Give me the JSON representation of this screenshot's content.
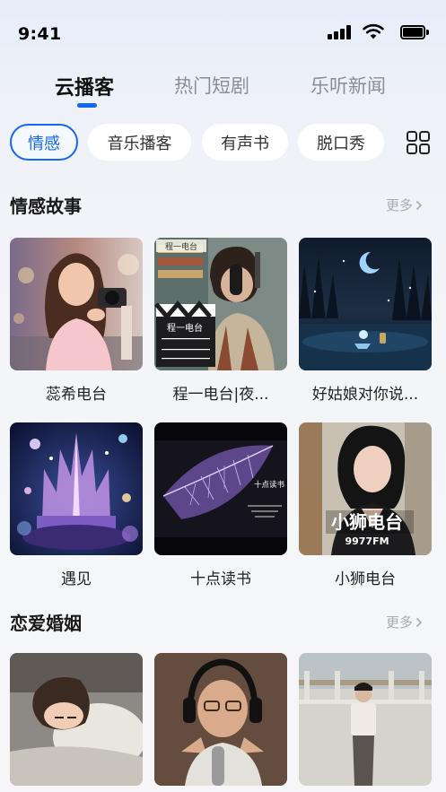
{
  "status_bar": {
    "time": "9:41"
  },
  "main_tabs": [
    {
      "label": "云播客",
      "active": true
    },
    {
      "label": "热门短剧",
      "active": false
    },
    {
      "label": "乐听新闻",
      "active": false
    }
  ],
  "chips": [
    {
      "label": "情感",
      "active": true
    },
    {
      "label": "音乐播客",
      "active": false
    },
    {
      "label": "有声书",
      "active": false
    },
    {
      "label": "脱口秀",
      "active": false
    }
  ],
  "sections": [
    {
      "title": "情感故事",
      "more": "更多",
      "items": [
        {
          "title": "蕊希电台"
        },
        {
          "title": "程一电台|夜..."
        },
        {
          "title": "好姑娘对你说..."
        },
        {
          "title": "遇见"
        },
        {
          "title": "十点读书"
        },
        {
          "title": "小狮电台"
        }
      ]
    },
    {
      "title": "恋爱婚姻",
      "more": "更多",
      "items": [
        {},
        {},
        {}
      ]
    }
  ],
  "cover_text": {
    "chengyi_sign": "程一电台",
    "slate_text": "程一电台",
    "tenpoint_logo": "十点读书",
    "lion_title": "小狮电台",
    "lion_freq": "9977FM"
  },
  "colors": {
    "accent": "#1467f0",
    "muted": "#8a8d94"
  }
}
